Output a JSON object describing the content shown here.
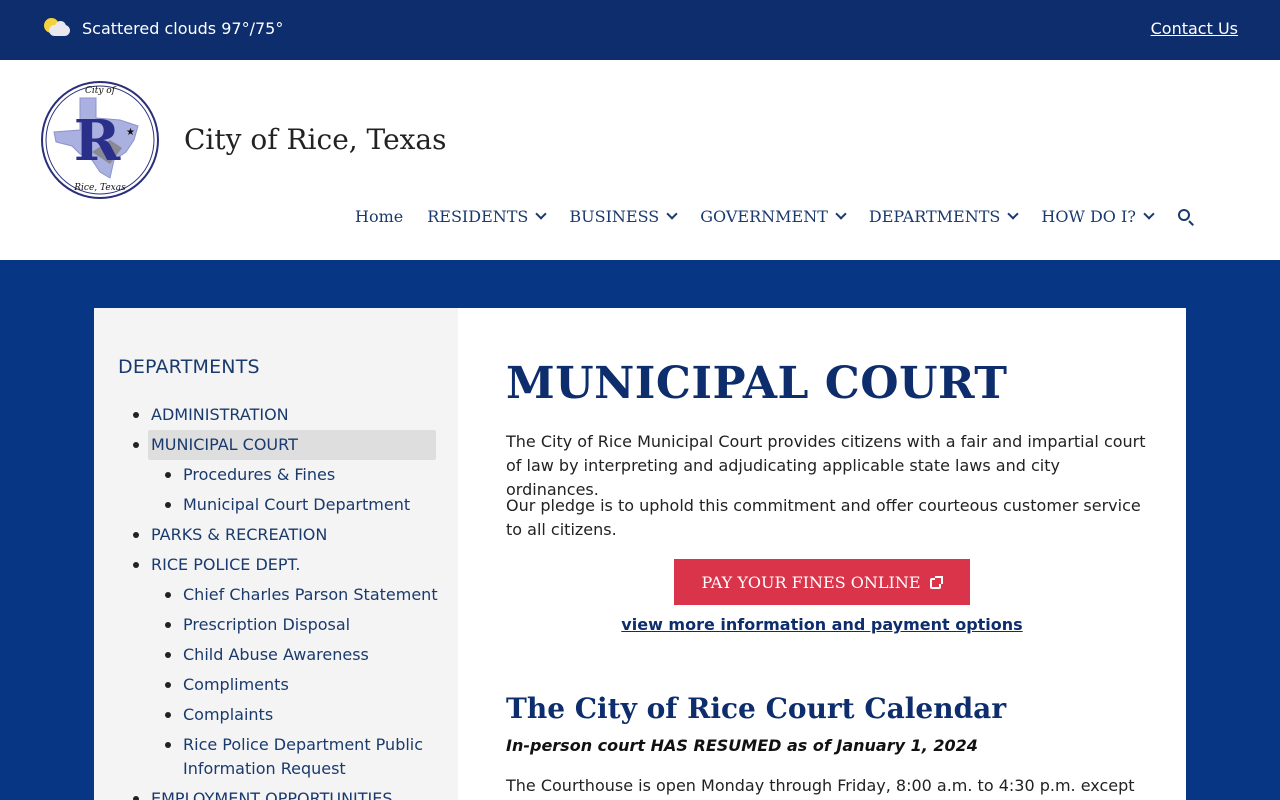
{
  "topbar": {
    "weather_icon": "partly-cloudy-icon",
    "weather_text": "Scattered clouds 97°/75°",
    "contact_label": "Contact Us"
  },
  "header": {
    "seal_top_text": "City of",
    "seal_letter": "R",
    "seal_bottom_text": "Rice, Texas",
    "site_name": "City of Rice, Texas",
    "nav": [
      {
        "label": "Home",
        "dropdown": false
      },
      {
        "label": "RESIDENTS",
        "dropdown": true
      },
      {
        "label": "BUSINESS",
        "dropdown": true
      },
      {
        "label": "GOVERNMENT",
        "dropdown": true
      },
      {
        "label": "DEPARTMENTS",
        "dropdown": true
      },
      {
        "label": "HOW DO I?",
        "dropdown": true
      }
    ],
    "search_icon": "search-icon"
  },
  "sidebar": {
    "title": "DEPARTMENTS",
    "items": [
      {
        "label": "ADMINISTRATION",
        "level": 1
      },
      {
        "label": "MUNICIPAL COURT",
        "level": 1,
        "active": true
      },
      {
        "label": "Procedures & Fines",
        "level": 2
      },
      {
        "label": "Municipal Court Department",
        "level": 2
      },
      {
        "label": "PARKS & RECREATION",
        "level": 1
      },
      {
        "label": "RICE POLICE DEPT.",
        "level": 1
      },
      {
        "label": "Chief Charles Parson Statement",
        "level": 2
      },
      {
        "label": "Prescription Disposal",
        "level": 2
      },
      {
        "label": "Child Abuse Awareness",
        "level": 2
      },
      {
        "label": "Compliments",
        "level": 2
      },
      {
        "label": "Complaints",
        "level": 2
      },
      {
        "label": "Rice Police Department Public Information Request",
        "level": 2
      },
      {
        "label": "EMPLOYMENT OPPORTUNITIES",
        "level": 1
      }
    ]
  },
  "main": {
    "title": "MUNICIPAL COURT",
    "para1": "The City of Rice Municipal Court provides citizens with a fair and impartial court of law by interpreting and adjudicating applicable state laws and city ordinances.",
    "para2": "Our pledge is to uphold this commitment and offer courteous customer service to all citizens.",
    "pay_button": "PAY YOUR FINES ONLINE",
    "more_link": "view more information and payment options",
    "calendar_title": "The City of Rice Court Calendar",
    "resumed_note": "In-person court HAS RESUMED as of January 1, 2024",
    "para3": "The Courthouse is open Monday through Friday, 8:00 a.m. to 4:30 p.m. except for"
  },
  "colors": {
    "topbar": "#0d2d6c",
    "band": "#073685",
    "button": "#d9344a",
    "link": "#1a3a6e"
  }
}
